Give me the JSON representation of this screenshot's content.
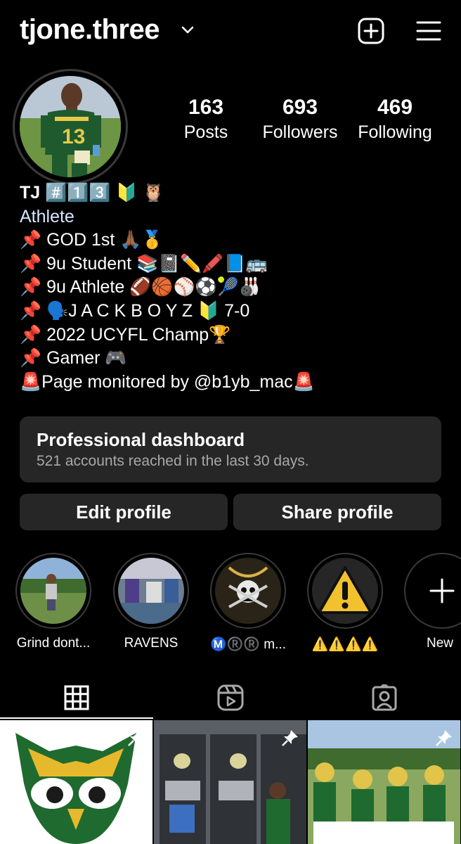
{
  "header": {
    "username": "tjone.three",
    "icons": {
      "chevron": "chevron-down-icon",
      "add": "plus-square-icon",
      "menu": "hamburger-menu-icon"
    }
  },
  "stats": {
    "posts": {
      "value": "163",
      "label": "Posts"
    },
    "followers": {
      "value": "693",
      "label": "Followers"
    },
    "following": {
      "value": "469",
      "label": "Following"
    }
  },
  "bio": {
    "name": "TJ #️⃣1️⃣3️⃣ 🔰 🦉",
    "category": "Athlete",
    "lines": [
      "📌 GOD 1st 🙏🏾🥇",
      "📌 9u Student 📚📓✏️🖍️📘🚌",
      "📌 9u Athlete 🏈🏀⚾⚽🎾🎳",
      "📌 🗣️J A C K B O Y Z 🔰 7-0",
      "📌 2022 UCYFL Champ🏆",
      "📌 Gamer 🎮",
      "🚨Page monitored by @b1yb_mac🚨"
    ]
  },
  "dashboard": {
    "title": "Professional dashboard",
    "subtitle": "521 accounts reached in the last 30 days."
  },
  "buttons": {
    "edit": "Edit profile",
    "share": "Share profile"
  },
  "highlights": [
    {
      "label": "Grind dont..."
    },
    {
      "label": "RAVENS"
    },
    {
      "label": "Ⓜ️®️®️ m..."
    },
    {
      "label": "⚠️⚠️⚠️⚠️"
    },
    {
      "label": "New"
    }
  ],
  "tabs": [
    {
      "name": "grid",
      "icon": "grid-icon",
      "active": true
    },
    {
      "name": "reels",
      "icon": "reels-icon",
      "active": false
    },
    {
      "name": "tagged",
      "icon": "tagged-person-icon",
      "active": false
    }
  ],
  "colors": {
    "background": "#000000",
    "card": "#262626",
    "muted_text": "#a8a8a8",
    "category_text": "#d8e6ff"
  }
}
